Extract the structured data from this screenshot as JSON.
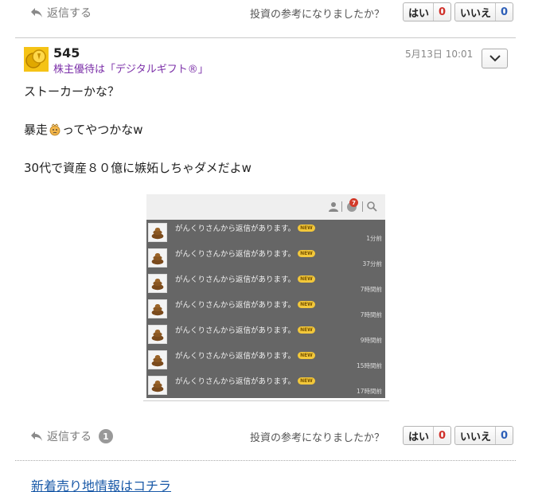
{
  "top_actions": {
    "reply_label": "返信する",
    "question": "投資の参考になりましたか？",
    "yes_label": "はい",
    "yes_count": "0",
    "no_label": "いいえ",
    "no_count": "0"
  },
  "post": {
    "username": "545",
    "tagline": "株主優待は「デジタルギフト®」",
    "timestamp": "5月13日 10:01",
    "lines": [
      "ストーカーかな？",
      "暴走",
      "ってやつかなw",
      "30代で資産８０億に嫉妬しちゃダメだよw"
    ],
    "embedded_screenshot": {
      "header_badge": "7",
      "notifications": [
        {
          "text": "がんくりさんから返信があります。",
          "badge": "NEW",
          "time": "1分前"
        },
        {
          "text": "がんくりさんから返信があります。",
          "badge": "NEW",
          "time": "37分前"
        },
        {
          "text": "がんくりさんから返信があります。",
          "badge": "NEW",
          "time": "7時間前"
        },
        {
          "text": "がんくりさんから返信があります。",
          "badge": "NEW",
          "time": "7時間前"
        },
        {
          "text": "がんくりさんから返信があります。",
          "badge": "NEW",
          "time": "9時間前"
        },
        {
          "text": "がんくりさんから返信があります。",
          "badge": "NEW",
          "time": "15時間前"
        },
        {
          "text": "がんくりさんから返信があります。",
          "badge": "NEW",
          "time": "17時間前"
        }
      ]
    }
  },
  "bottom_actions": {
    "reply_label": "返信する",
    "reply_count": "1",
    "question": "投資の参考になりましたか？",
    "yes_label": "はい",
    "yes_count": "0",
    "no_label": "いいえ",
    "no_count": "0"
  },
  "footer_link": "新着売り地情報はコチラ",
  "icons": {
    "reply": "reply-arrow-icon",
    "menu": "chevron-down-icon",
    "avatar": "gold-coin-avatar-icon",
    "emoji": "angry-face-emoji-icon",
    "thumb": "poop-icon",
    "user": "user-icon",
    "bell": "bell-icon",
    "search": "search-icon"
  },
  "colors": {
    "tagline": "#7b2fa8",
    "yes_count": "#d0302a",
    "no_count": "#2d5fb8",
    "link": "#1a5aa8"
  }
}
